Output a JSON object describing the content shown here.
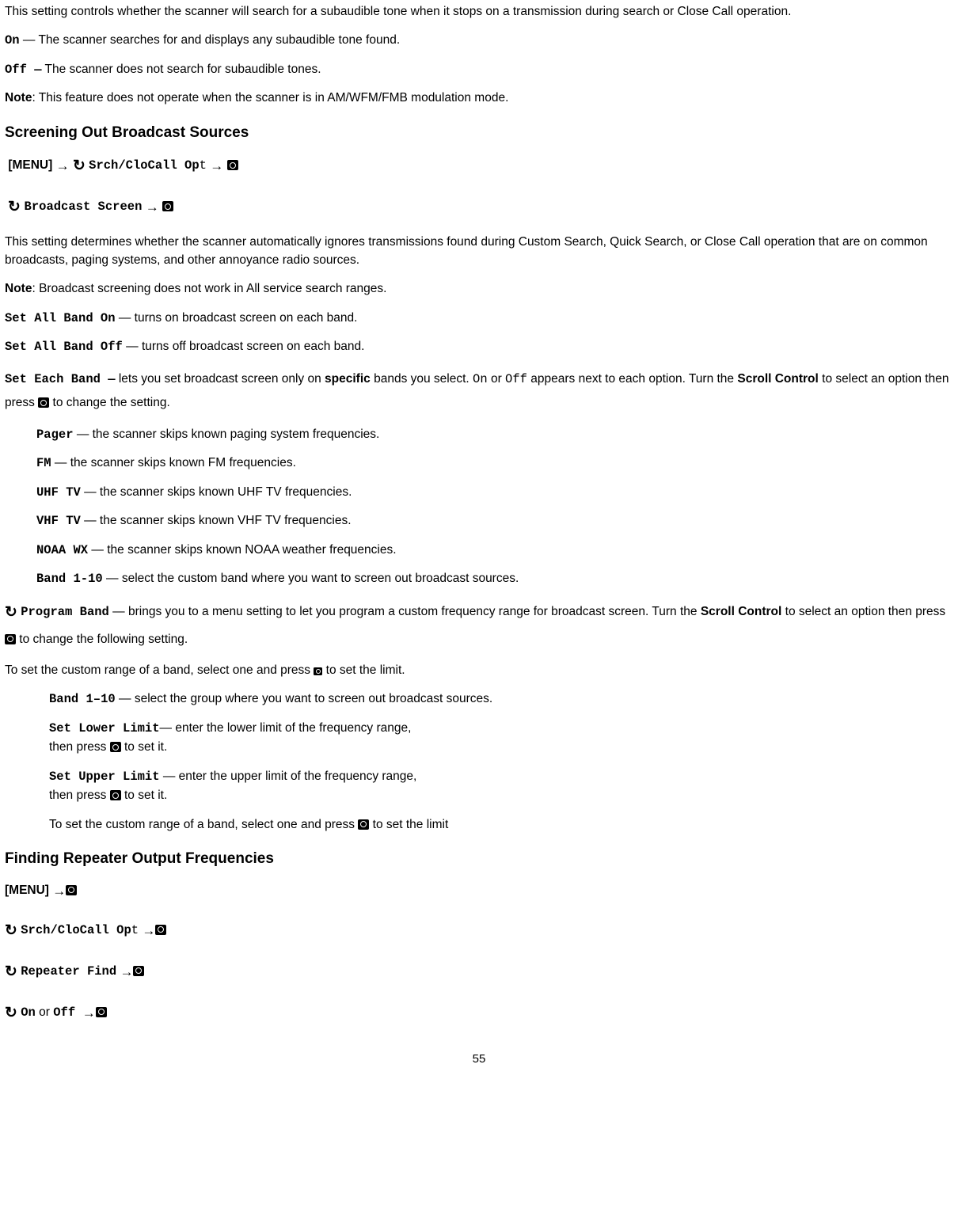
{
  "intro_p1": "This setting controls whether the scanner will search for a subaudible tone when it stops on a transmission during search or Close Call operation.",
  "on_label": "On",
  "on_desc": " — The scanner searches for and displays any subaudible tone found.",
  "off_label": "Off —",
  "off_desc": " The scanner does not search for subaudible tones.",
  "note1_label": "Note",
  "note1_text": ": This feature does not operate when the scanner is in AM/WFM/FMB modulation mode.",
  "h_broadcast": "Screening Out Broadcast Sources",
  "menu_label": "[MENU]",
  "nav_srch_opt_a": "Srch/CloCall Op",
  "nav_srch_opt_b": "t",
  "nav_broadcast_screen": "Broadcast Screen",
  "broadcast_p": "This setting determines whether the scanner automatically ignores transmissions found during Custom Search, Quick Search, or Close Call operation that are on common broadcasts, paging systems, and other annoyance radio sources.",
  "note2_label": "Note",
  "note2_text": ": Broadcast screening does not work in All service search ranges.",
  "set_all_on_label": "Set All Band On",
  "set_all_on_desc": " — turns on broadcast screen on each band.",
  "set_all_off_label": "Set All Band Off",
  "set_all_off_desc": " — turns off broadcast screen on each band.",
  "set_each_label": "Set Each Band —",
  "set_each_desc_a": " lets you set broadcast screen only on ",
  "set_each_specific": "specific",
  "set_each_desc_b": " bands you select. ",
  "set_each_on": "On",
  "set_each_or": " or ",
  "set_each_off": "Off",
  "set_each_desc_c": " appears next to each option. Turn the ",
  "scroll_control": "Scroll Control",
  "set_each_desc_d": " to select an option then press ",
  "set_each_desc_e": " to change the setting.",
  "pager_label": "Pager",
  "pager_desc": " — the scanner skips known paging system frequencies.",
  "fm_label": "FM",
  "fm_desc": " — the scanner skips known FM frequencies.",
  "uhf_label": "UHF TV",
  "uhf_desc": " —  the scanner skips known UHF TV frequencies.",
  "vhf_label": "VHF TV",
  "vhf_desc": " —  the scanner skips known VHF TV frequencies.",
  "noaa_label": "NOAA WX",
  "noaa_desc": " —  the scanner skips known NOAA weather frequencies.",
  "band110_label": "Band 1-10",
  "band110_desc": " — select the custom band where you want to screen out broadcast sources.",
  "program_band_label": "Program Band",
  "program_band_desc_a": " — brings you to a menu setting to let you program a custom frequency range for broadcast screen. Turn the ",
  "program_band_desc_b": " to select an option then press ",
  "program_band_desc_c": " to change the following setting.",
  "custom_range_intro_a": "To set the custom range of a band, select one and press ",
  "custom_range_intro_b": " to set the limit.",
  "band110b_label": "Band 1–10",
  "band110b_desc": " — select the group where you want to screen out broadcast sources.",
  "lower_label": "Set Lower Limit",
  "lower_desc": "— enter the lower limit of the frequency range,",
  "then_press_a": "then press ",
  "then_press_b": " to set it.",
  "upper_label": "Set Upper Limit",
  "upper_desc": " — enter the upper limit of the frequency range,",
  "custom_range_outro_a": "To set the custom range of a band, select one and press ",
  "custom_range_outro_b": " to set the limit",
  "h_repeater": "Finding Repeater Output Frequencies",
  "nav_repeater_find": "Repeater Find",
  "nav_on": "On",
  "nav_or": " or ",
  "nav_off": "Off",
  "page_number": "55"
}
